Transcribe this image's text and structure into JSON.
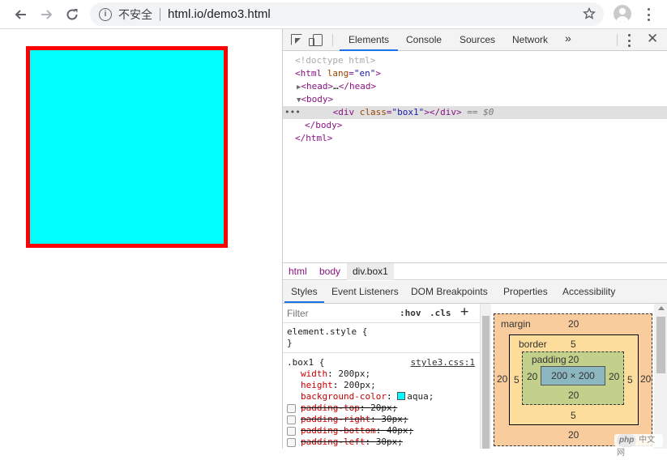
{
  "browser": {
    "back_icon": "arrow-left-icon",
    "forward_icon": "arrow-right-icon",
    "reload_icon": "reload-icon",
    "security_text": "不安全",
    "url": "html.io/demo3.html"
  },
  "page": {
    "box": {
      "background": "#00ffff",
      "border_color": "#ff0000"
    }
  },
  "devtools": {
    "tabs": [
      "Elements",
      "Console",
      "Sources",
      "Network"
    ],
    "more": "»",
    "close": "✕",
    "dom": {
      "doctype": "<!doctype html>",
      "html_open_tag": "html",
      "html_lang_attr": "lang",
      "html_lang_val": "\"en\"",
      "head_tag": "head",
      "head_ellipsis": "…",
      "body_tag": "body",
      "div_tag": "div",
      "div_class_attr": "class",
      "div_class_val": "\"box1\"",
      "selected_suffix": "== $0",
      "body_close": "</body>",
      "html_close": "</html>"
    },
    "breadcrumbs": [
      "html",
      "body",
      "div.box1"
    ],
    "sub_tabs": [
      "Styles",
      "Event Listeners",
      "DOM Breakpoints",
      "Properties",
      "Accessibility"
    ],
    "styles": {
      "filter_placeholder": "Filter",
      "hov": ":hov",
      "cls": ".cls",
      "plus": "+",
      "element_style": "element.style {",
      "element_style_close": "}",
      "selector": ".box1 {",
      "source": "style3.css:1",
      "props": [
        {
          "name": "width",
          "value": "200px;",
          "struck": false
        },
        {
          "name": "height",
          "value": "200px;",
          "struck": false
        },
        {
          "name": "background-color",
          "value": "aqua;",
          "struck": false
        },
        {
          "name": "padding-top",
          "value": "20px;",
          "struck": true
        },
        {
          "name": "padding-right",
          "value": "30px;",
          "struck": true
        },
        {
          "name": "padding-bottom",
          "value": "40px;",
          "struck": true
        },
        {
          "name": "padding-left",
          "value": "30px;",
          "struck": true
        }
      ]
    },
    "box_model": {
      "margin_label": "margin",
      "margin_top": "20",
      "margin_left": "20",
      "margin_right": "20",
      "margin_bottom": "20",
      "border_label": "border",
      "border_top": "5",
      "border_left": "5",
      "border_right": "5",
      "border_bottom": "5",
      "padding_label": "padding",
      "padding_top": "20",
      "padding_left": "20",
      "padding_right": "20",
      "padding_bottom": "20",
      "content": "200 × 200"
    }
  },
  "watermark": {
    "logo": "php",
    "text": "中文网"
  }
}
